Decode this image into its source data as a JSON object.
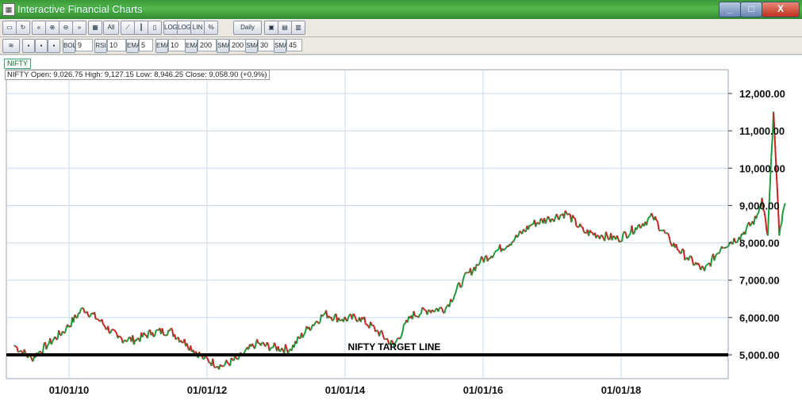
{
  "window": {
    "title": "Interactive Financial Charts",
    "buttons": {
      "minimize": "_",
      "maximize": "□",
      "close": "X"
    }
  },
  "toolbar": {
    "interval": "Daily",
    "range": "All",
    "indicators": [
      {
        "label": "BOL",
        "value": "9"
      },
      {
        "label": "RSI",
        "value": "10"
      },
      {
        "label": "EMA",
        "value": "5"
      },
      {
        "label": "EMA",
        "value": "10"
      },
      {
        "label": "EMA",
        "value": "200"
      },
      {
        "label": "SMA",
        "value": "200"
      },
      {
        "label": "SMA",
        "value": "30"
      },
      {
        "label": "SMA",
        "value": "45"
      }
    ]
  },
  "legend": "NIFTY",
  "ohlc_line": "NIFTY Open: 9,026.75  High: 9,127.15  Low: 8,946.25  Close: 9,058.90  (+0.9%)",
  "colors": {
    "up": "#1a9a3a",
    "down": "#cc2020",
    "target_line": "#000000",
    "grid": "#c8d8ea"
  },
  "chart_data": {
    "type": "line",
    "series_name": "NIFTY",
    "x": [
      "2009-03",
      "2009-06",
      "2009-09",
      "2009-12",
      "2010-03",
      "2010-06",
      "2010-09",
      "2010-12",
      "2011-03",
      "2011-06",
      "2011-09",
      "2011-12",
      "2012-03",
      "2012-06",
      "2012-09",
      "2012-12",
      "2013-03",
      "2013-06",
      "2013-09",
      "2013-12",
      "2014-03",
      "2014-06",
      "2014-09",
      "2014-12",
      "2015-03",
      "2015-06",
      "2015-09",
      "2015-12",
      "2016-03",
      "2016-06",
      "2016-09",
      "2016-12",
      "2017-03",
      "2017-06",
      "2017-09",
      "2017-12",
      "2018-03",
      "2018-06",
      "2018-09",
      "2018-12",
      "2019-03",
      "2019-06",
      "2019-09",
      "2019-12",
      "2020-01",
      "2020-02",
      "2020-03",
      "2020-04",
      "2020-05"
    ],
    "y": [
      5250,
      4900,
      5300,
      5700,
      6250,
      5900,
      5450,
      5400,
      5600,
      5650,
      5300,
      4900,
      4700,
      4900,
      5300,
      5200,
      5150,
      5700,
      6100,
      5950,
      6000,
      5650,
      5250,
      6050,
      6200,
      6250,
      7000,
      7500,
      7800,
      8100,
      8500,
      8650,
      8800,
      8300,
      8200,
      8100,
      8400,
      8700,
      8050,
      7600,
      7250,
      7900,
      8150,
      8650,
      9200,
      8200,
      11500,
      8200,
      9050
    ],
    "target_line": {
      "value": 5000,
      "label": "NIFTY TARGET LINE"
    },
    "y_ticks": [
      "5,000.00",
      "6,000.00",
      "7,000.00",
      "8,000.00",
      "9,000.00",
      "10,000.00",
      "11,000.00",
      "12,000.00"
    ],
    "y_tick_values": [
      5000,
      6000,
      7000,
      8000,
      9000,
      10000,
      11000,
      12000
    ],
    "x_ticks": [
      "01/01/10",
      "01/01/12",
      "01/01/14",
      "01/01/16",
      "01/01/18"
    ],
    "ylim": [
      4500,
      12500
    ],
    "grid": true,
    "legend_position": "top-left"
  }
}
